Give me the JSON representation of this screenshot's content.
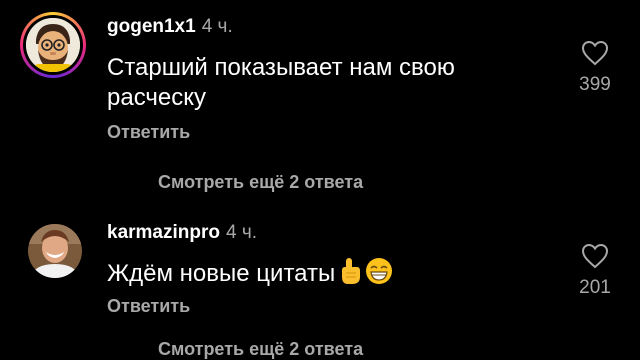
{
  "comments": [
    {
      "username": "gogen1x1",
      "time": "4 ч.",
      "text_line1": "Старший показывает нам свою",
      "text_line2": "расческу",
      "reply_label": "Ответить",
      "likes": "399"
    },
    {
      "username": "karmazinpro",
      "time": "4 ч.",
      "text": "Ждём новые цитаты",
      "emojis": [
        "pointing-up-icon",
        "grinning-face-icon"
      ],
      "reply_label": "Ответить",
      "likes": "201"
    }
  ],
  "view_more_1": "Смотреть ещё 2 ответа",
  "view_more_2": "Смотреть ещё 2 ответа",
  "colors": {
    "background": "#000000",
    "primary_text": "#ffffff",
    "secondary_text": "#a8a8a8"
  }
}
